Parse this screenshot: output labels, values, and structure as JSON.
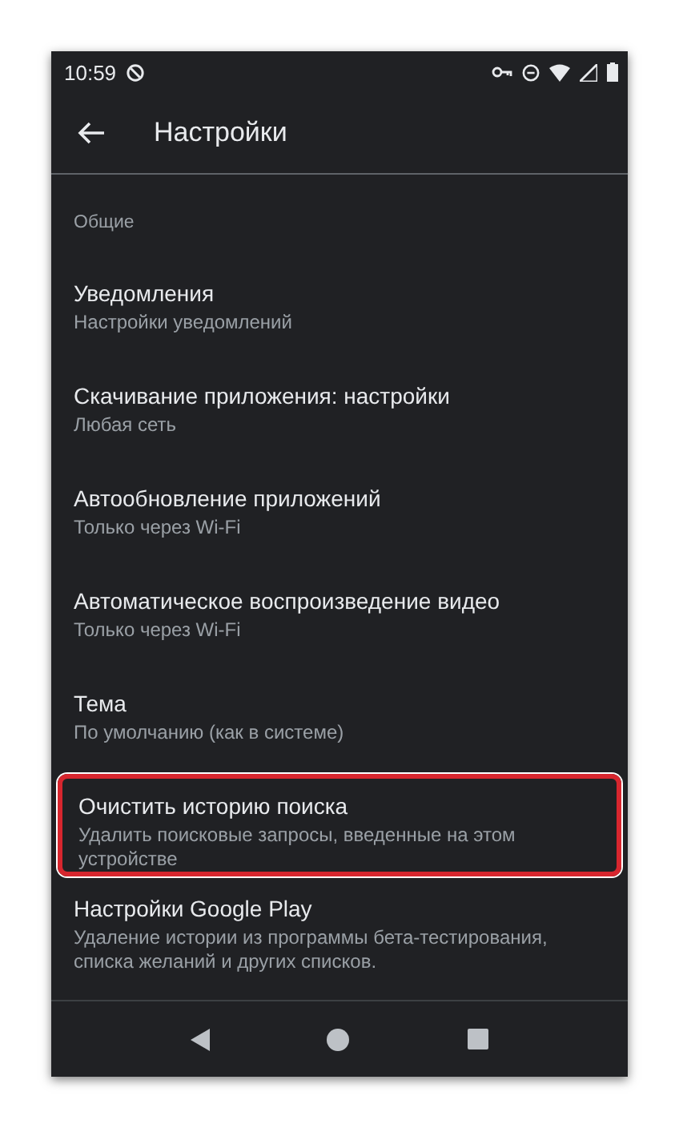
{
  "status_bar": {
    "time": "10:59"
  },
  "app_bar": {
    "title": "Настройки"
  },
  "section": {
    "title": "Общие"
  },
  "items": [
    {
      "title": "Уведомления",
      "subtitle": "Настройки уведомлений",
      "highlighted": false
    },
    {
      "title": "Скачивание приложения: настройки",
      "subtitle": "Любая сеть",
      "highlighted": false
    },
    {
      "title": "Автообновление приложений",
      "subtitle": "Только через Wi-Fi",
      "highlighted": false
    },
    {
      "title": "Автоматическое воспроизведение видео",
      "subtitle": "Только через Wi-Fi",
      "highlighted": false
    },
    {
      "title": "Тема",
      "subtitle": "По умолчанию (как в системе)",
      "highlighted": false
    },
    {
      "title": "Очистить историю поиска",
      "subtitle": "Удалить поисковые запросы, введенные на этом устройстве",
      "highlighted": true
    },
    {
      "title": "Настройки Google Play",
      "subtitle": "Удаление истории из программы бета-тестирования, списка желаний и других списков.",
      "highlighted": false
    }
  ]
}
